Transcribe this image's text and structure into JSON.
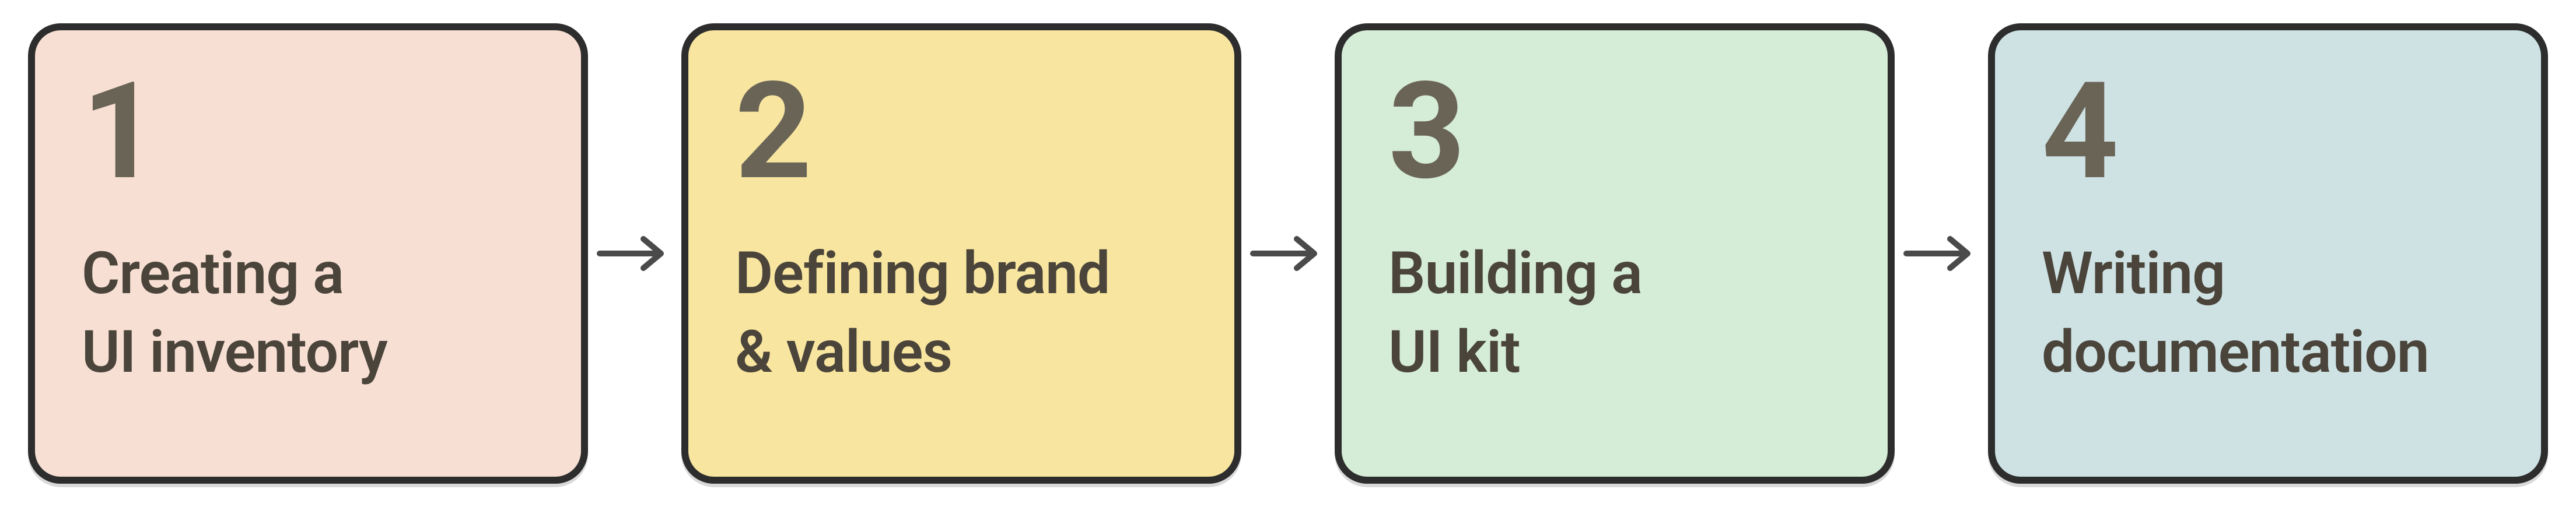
{
  "steps": [
    {
      "number": "1",
      "title_l1": "Creating a",
      "title_l2": "UI inventory",
      "bg": "#f8dfd4"
    },
    {
      "number": "2",
      "title_l1": "Defining brand",
      "title_l2": "& values",
      "bg": "#f8e6a0"
    },
    {
      "number": "3",
      "title_l1": "Building a",
      "title_l2": "UI kit",
      "bg": "#d5ecd6"
    },
    {
      "number": "4",
      "title_l1": "Writing",
      "title_l2": "documentation",
      "bg": "#cee2e4"
    }
  ],
  "colors": {
    "border": "#2d2d2d",
    "number_text": "#6a6457",
    "title_text": "#4a443a",
    "arrow": "#4a4a4a"
  }
}
